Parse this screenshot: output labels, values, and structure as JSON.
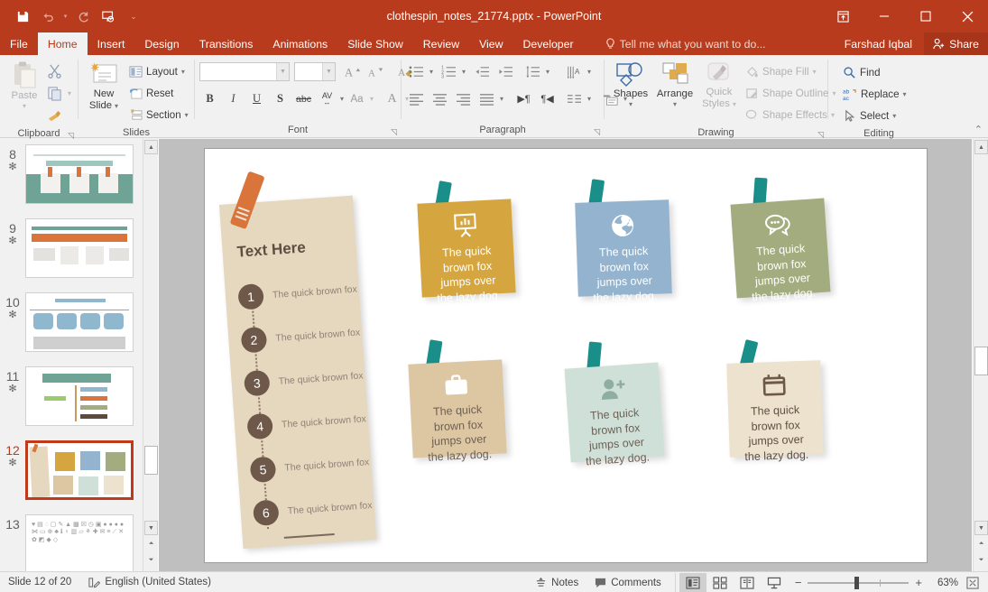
{
  "window": {
    "title": "clothespin_notes_21774.pptx - PowerPoint",
    "quick_access": [
      {
        "name": "save-icon",
        "label": "Save"
      },
      {
        "name": "undo-icon",
        "label": "Undo"
      },
      {
        "name": "redo-icon",
        "label": "Redo"
      },
      {
        "name": "start-presentation-icon",
        "label": "Start From Beginning"
      },
      {
        "name": "customize-qat-icon",
        "label": "Customize Quick Access Toolbar"
      }
    ],
    "controls": [
      {
        "name": "ribbon-display-options-icon",
        "glyph": "⤒"
      },
      {
        "name": "minimize-button",
        "glyph": "—"
      },
      {
        "name": "maximize-button",
        "glyph": "☐"
      },
      {
        "name": "close-button",
        "glyph": "✕"
      }
    ]
  },
  "tabs": [
    {
      "label": "File",
      "active": false
    },
    {
      "label": "Home",
      "active": true
    },
    {
      "label": "Insert",
      "active": false
    },
    {
      "label": "Design",
      "active": false
    },
    {
      "label": "Transitions",
      "active": false
    },
    {
      "label": "Animations",
      "active": false
    },
    {
      "label": "Slide Show",
      "active": false
    },
    {
      "label": "Review",
      "active": false
    },
    {
      "label": "View",
      "active": false
    },
    {
      "label": "Developer",
      "active": false
    }
  ],
  "tellme": {
    "label": "Tell me what you want to do..."
  },
  "account": {
    "user": "Farshad Iqbal",
    "share_label": "Share"
  },
  "ribbon": {
    "groups": [
      {
        "name": "clipboard",
        "label": "Clipboard",
        "paste_label": "Paste",
        "items": [
          {
            "label": "Cut",
            "name": "cut-button"
          },
          {
            "label": "Copy",
            "name": "copy-button"
          },
          {
            "label": "Format Painter",
            "name": "format-painter-button"
          }
        ]
      },
      {
        "name": "slides",
        "label": "Slides",
        "new_slide_label": "New\nSlide",
        "new_slide_line1": "New",
        "new_slide_line2": "Slide",
        "items": [
          {
            "label": "Layout",
            "name": "layout-button"
          },
          {
            "label": "Reset",
            "name": "reset-button"
          },
          {
            "label": "Section",
            "name": "section-button"
          }
        ]
      },
      {
        "name": "font",
        "label": "Font",
        "font_name_value": "",
        "font_size_value": "",
        "buttons": [
          {
            "label": "B",
            "name": "bold-button"
          },
          {
            "label": "I",
            "name": "italic-button"
          },
          {
            "label": "U",
            "name": "underline-button"
          },
          {
            "label": "S",
            "name": "shadow-button"
          },
          {
            "label": "abc",
            "name": "strikethrough-button"
          },
          {
            "label": "AV",
            "name": "character-spacing-button"
          },
          {
            "label": "Aa",
            "name": "change-case-button"
          },
          {
            "label": "A",
            "name": "font-color-button"
          }
        ],
        "grow_label": "A",
        "shrink_label": "A",
        "clear_format_label": "Clear All Formatting"
      },
      {
        "name": "paragraph",
        "label": "Paragraph"
      },
      {
        "name": "drawing",
        "label": "Drawing",
        "shapes_label": "Shapes",
        "arrange_label": "Arrange",
        "quick_styles_line1": "Quick",
        "quick_styles_line2": "Styles",
        "items": [
          {
            "label": "Shape Fill",
            "name": "shape-fill-button"
          },
          {
            "label": "Shape Outline",
            "name": "shape-outline-button"
          },
          {
            "label": "Shape Effects",
            "name": "shape-effects-button"
          }
        ]
      },
      {
        "name": "editing",
        "label": "Editing",
        "items": [
          {
            "label": "Find",
            "name": "find-button"
          },
          {
            "label": "Replace",
            "name": "replace-button"
          },
          {
            "label": "Select",
            "name": "select-button"
          }
        ]
      }
    ]
  },
  "thumbnails": [
    {
      "number": "8",
      "animated": true,
      "selected": false
    },
    {
      "number": "9",
      "animated": true,
      "selected": false
    },
    {
      "number": "10",
      "animated": true,
      "selected": false
    },
    {
      "number": "11",
      "animated": true,
      "selected": false
    },
    {
      "number": "12",
      "animated": true,
      "selected": true
    },
    {
      "number": "13",
      "animated": false,
      "selected": false
    }
  ],
  "slide": {
    "big_note": {
      "heading": "Text Here",
      "pin_color": "#d9753a",
      "background": "#e6d7bf",
      "items": [
        {
          "number": "1",
          "text": "The quick brown fox"
        },
        {
          "number": "2",
          "text": "The quick brown fox"
        },
        {
          "number": "3",
          "text": "The quick brown fox"
        },
        {
          "number": "4",
          "text": "The quick brown fox"
        },
        {
          "number": "5",
          "text": "The quick brown fox"
        },
        {
          "number": "6",
          "text": "The quick brown fox"
        }
      ]
    },
    "notes": [
      {
        "icon": "presentation-chart-icon",
        "text": "The quick brown fox jumps over the lazy dog.",
        "bg": "#d5a63f",
        "fg": "#ffffff",
        "pin": "#1a8f8a"
      },
      {
        "icon": "globe-icon",
        "text": "The quick brown fox jumps over the lazy dog.",
        "bg": "#93b3ce",
        "fg": "#ffffff",
        "pin": "#1a8f8a"
      },
      {
        "icon": "chat-bubbles-icon",
        "text": "The quick brown fox jumps over the lazy dog.",
        "bg": "#a3ac7e",
        "fg": "#ffffff",
        "pin": "#1a8f8a"
      },
      {
        "icon": "briefcase-icon",
        "text": "The quick brown fox jumps over the lazy dog.",
        "bg": "#ddc6a2",
        "fg": "#6e6054",
        "pin": "#1a8f8a"
      },
      {
        "icon": "add-user-icon",
        "text": "The quick brown fox jumps over the lazy dog.",
        "bg": "#cfe0d8",
        "fg": "#6e6054",
        "pin": "#1a8f8a"
      },
      {
        "icon": "calendar-icon",
        "text": "The quick brown fox jumps over the lazy dog.",
        "bg": "#ece2cd",
        "fg": "#5e4f43",
        "pin": "#1a8f8a"
      }
    ]
  },
  "statusbar": {
    "slide_counter": "Slide 12 of 20",
    "language": "English (United States)",
    "notes_label": "Notes",
    "comments_label": "Comments",
    "views": [
      {
        "name": "normal-view-button",
        "active": true
      },
      {
        "name": "slide-sorter-view-button",
        "active": false
      },
      {
        "name": "reading-view-button",
        "active": false
      },
      {
        "name": "slide-show-button",
        "active": false
      }
    ],
    "zoom_out_label": "−",
    "zoom_in_label": "+",
    "zoom_level": "63%"
  }
}
